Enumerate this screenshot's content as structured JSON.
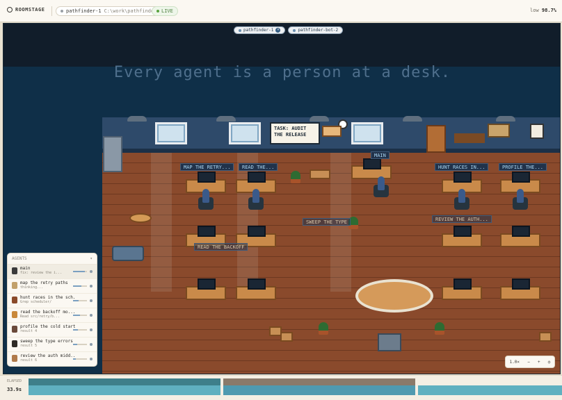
{
  "topbar": {
    "logo": "ROOMSTAGE",
    "session_name": "pathfinder-1",
    "session_path": "C:\\work\\pathfinder",
    "live_label": "LIVE",
    "zoom_prefix": "low",
    "zoom_value": "98.7%"
  },
  "tabs": [
    {
      "label": "pathfinder-1",
      "close": "×"
    },
    {
      "label": "pathfinder-bot-2"
    }
  ],
  "headline": "Every agent is a person at a desk.",
  "sign": {
    "line1": "TASK: AUDIT",
    "line2": "THE RELEASE"
  },
  "desk_labels": [
    "MAP THE RETRY...",
    "READ THE...",
    "MAIN",
    "HUNT RACES IN...",
    "PROFILE THE...",
    "SWEEP THE TYPE",
    "REVIEW THE AUTH...",
    "READ THE BACKOFF"
  ],
  "agents_panel": {
    "header": "AGENTS",
    "agents": [
      {
        "title": "main",
        "subtitle": "fix: review the i...",
        "progress": 0.85,
        "color": "#3a3a3a"
      },
      {
        "title": "map the retry paths",
        "subtitle": "thinking...",
        "progress": 0.6,
        "color": "#c2a06a"
      },
      {
        "title": "hunt races in the sch...",
        "subtitle": "Grep scheduler/",
        "progress": 0.4,
        "color": "#8a4a2a"
      },
      {
        "title": "read the backoff mo...",
        "subtitle": "Read src/retry/b...",
        "progress": 0.5,
        "color": "#c9883a"
      },
      {
        "title": "profile the cold start",
        "subtitle": "result 4",
        "progress": 0.35,
        "color": "#6a4a3a"
      },
      {
        "title": "sweep the type errors",
        "subtitle": "result 5",
        "progress": 0.3,
        "color": "#2e2a26"
      },
      {
        "title": "review the auth midd...",
        "subtitle": "result 6",
        "progress": 0.2,
        "color": "#b07a4a"
      }
    ]
  },
  "zoom_control": {
    "value": "1.0×",
    "minus": "−",
    "plus": "+",
    "reset": "◎"
  },
  "bottom": {
    "elapsed_label": "ELAPSED",
    "elapsed_value": "33.9s",
    "segments": [
      {
        "start": 0.0,
        "end": 0.36,
        "top": "#3e7f8a",
        "bottom": "#5fb0c0"
      },
      {
        "start": 0.365,
        "end": 0.725,
        "top": "#8a7a6a",
        "bottom": "#4f9ab0"
      },
      {
        "start": 0.73,
        "end": 1.0,
        "top": "#f4efe4",
        "bottom": "#5fb0c0"
      }
    ]
  },
  "colors": {
    "stage_bg": "#0f2f48",
    "floor": "#8a4a2c",
    "wall": "#2e4a6a",
    "label_bg": "#21324a",
    "label_text": "#a8d4f0"
  }
}
